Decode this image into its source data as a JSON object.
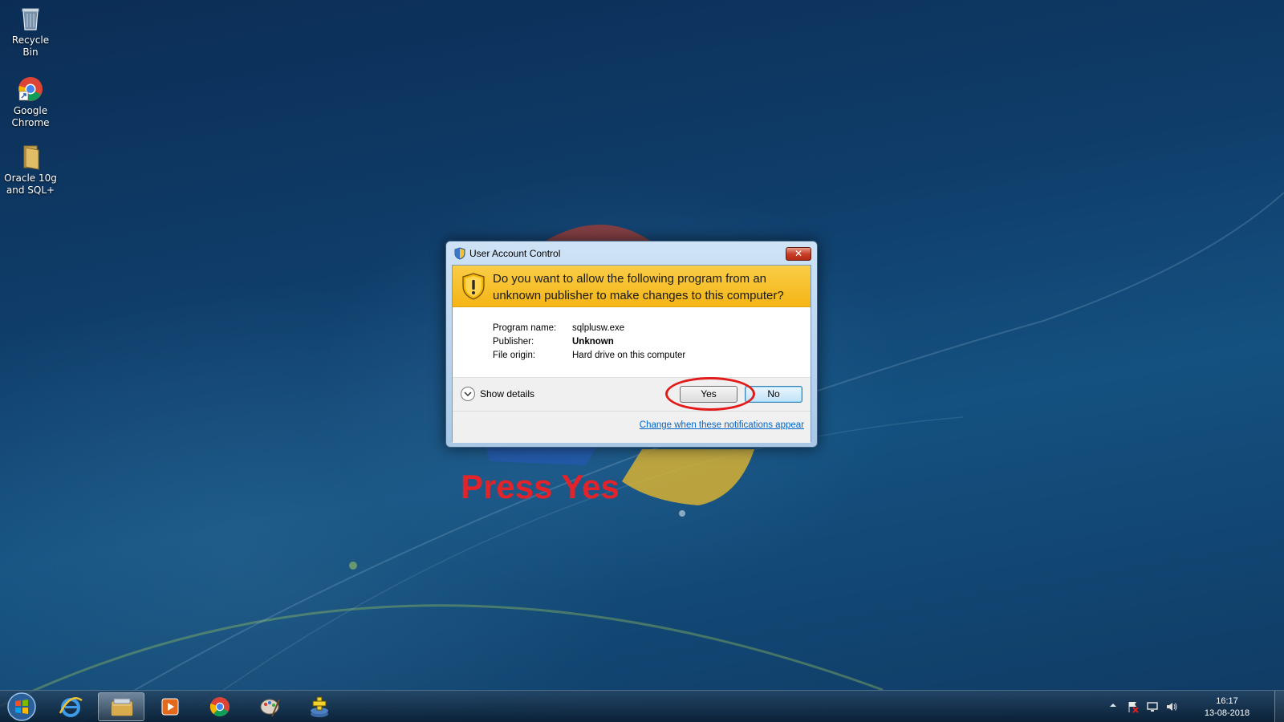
{
  "desktop": {
    "icons": [
      {
        "label": "Recycle Bin",
        "icon": "recycle-bin-icon"
      },
      {
        "label": "Google Chrome",
        "icon": "chrome-icon"
      },
      {
        "label": "Oracle 10g and SQL+",
        "icon": "folder-icon"
      }
    ]
  },
  "uac": {
    "title": "User Account Control",
    "close_label": "✕",
    "question": "Do you want to allow the following program from an unknown publisher to make changes to this computer?",
    "info": [
      {
        "label": "Program name:",
        "value": "sqlplusw.exe",
        "bold": false
      },
      {
        "label": "Publisher:",
        "value": "Unknown",
        "bold": true
      },
      {
        "label": "File origin:",
        "value": "Hard drive on this computer",
        "bold": false
      }
    ],
    "show_details_label": "Show details",
    "yes_label": "Yes",
    "no_label": "No",
    "change_link": "Change when these notifications appear"
  },
  "annotation": {
    "text": "Press Yes",
    "color": "#e2232a"
  },
  "taskbar": {
    "items": [
      "start-orb-icon",
      "internet-explorer-icon",
      "file-explorer-icon",
      "media-player-icon",
      "chrome-icon",
      "paint-icon",
      "installer-icon"
    ],
    "clock_time": "16:17",
    "clock_date": "13-08-2018"
  }
}
